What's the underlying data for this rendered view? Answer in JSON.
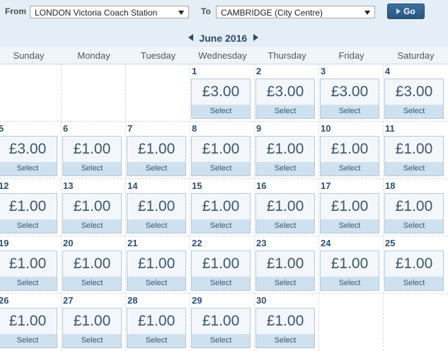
{
  "search": {
    "from_label": "From",
    "from_value": "LONDON Victoria Coach Station",
    "to_label": "To",
    "to_value": "CAMBRIDGE (City Centre)",
    "go_label": "Go"
  },
  "calendar": {
    "month_label": "June 2016",
    "weekdays": [
      "Sunday",
      "Monday",
      "Tuesday",
      "Wednesday",
      "Thursday",
      "Friday",
      "Saturday"
    ],
    "select_label": "Select",
    "days": [
      {
        "day": "1",
        "price": "£3.00"
      },
      {
        "day": "2",
        "price": "£3.00"
      },
      {
        "day": "3",
        "price": "£3.00"
      },
      {
        "day": "4",
        "price": "£3.00"
      },
      {
        "day": "5",
        "price": "£3.00"
      },
      {
        "day": "6",
        "price": "£1.00"
      },
      {
        "day": "7",
        "price": "£1.00"
      },
      {
        "day": "8",
        "price": "£1.00"
      },
      {
        "day": "9",
        "price": "£1.00"
      },
      {
        "day": "10",
        "price": "£1.00"
      },
      {
        "day": "11",
        "price": "£1.00"
      },
      {
        "day": "12",
        "price": "£1.00"
      },
      {
        "day": "13",
        "price": "£1.00"
      },
      {
        "day": "14",
        "price": "£1.00"
      },
      {
        "day": "15",
        "price": "£1.00"
      },
      {
        "day": "16",
        "price": "£1.00"
      },
      {
        "day": "17",
        "price": "£1.00"
      },
      {
        "day": "18",
        "price": "£1.00"
      },
      {
        "day": "19",
        "price": "£1.00"
      },
      {
        "day": "20",
        "price": "£1.00"
      },
      {
        "day": "21",
        "price": "£1.00"
      },
      {
        "day": "22",
        "price": "£1.00"
      },
      {
        "day": "23",
        "price": "£1.00"
      },
      {
        "day": "24",
        "price": "£1.00"
      },
      {
        "day": "25",
        "price": "£1.00"
      },
      {
        "day": "26",
        "price": "£1.00"
      },
      {
        "day": "27",
        "price": "£1.00"
      },
      {
        "day": "28",
        "price": "£1.00"
      },
      {
        "day": "29",
        "price": "£1.00"
      },
      {
        "day": "30",
        "price": "£1.00"
      }
    ]
  }
}
